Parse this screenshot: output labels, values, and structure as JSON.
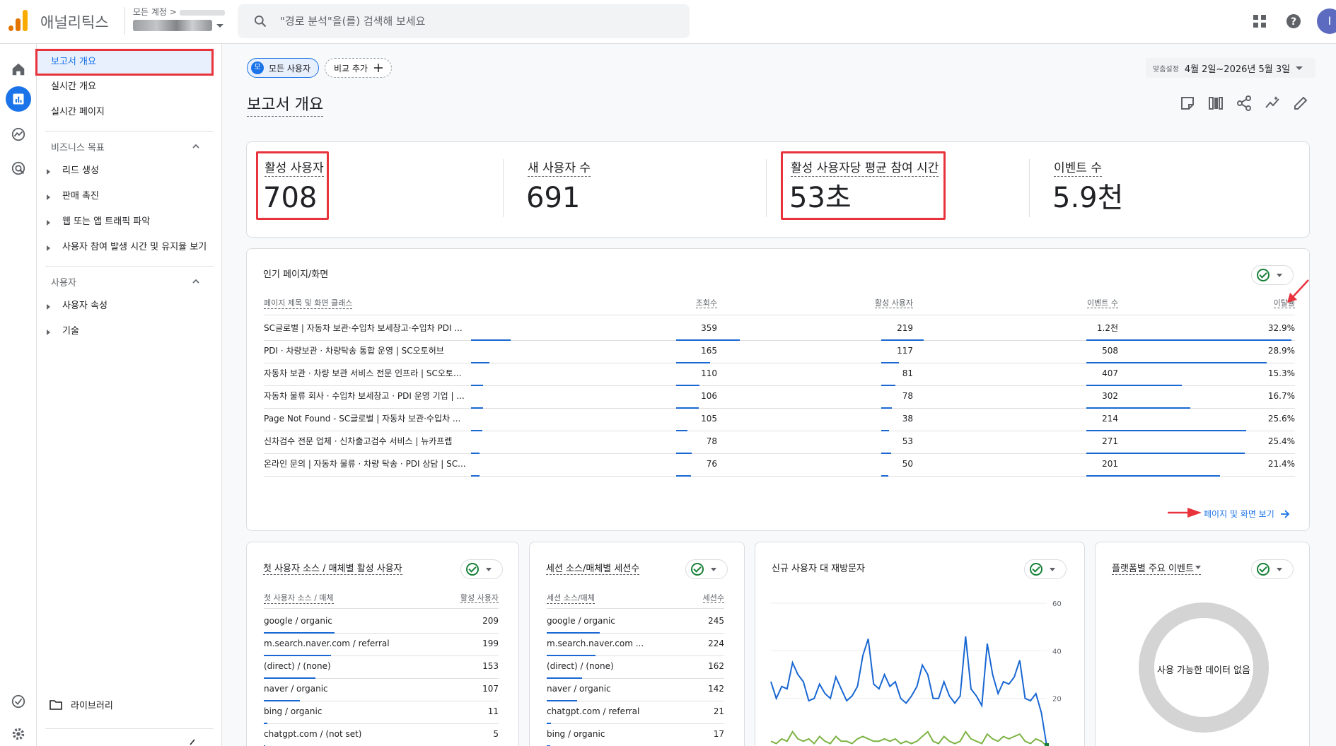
{
  "header": {
    "app_title": "애널리틱스",
    "account_path": "모든 계정 >",
    "search_placeholder": "\"경로 분석\"을(를) 검색해 보세요",
    "avatar_initial": "I"
  },
  "sidenav": {
    "top_items": [
      "보고서 개요",
      "실시간 개요",
      "실시간 페이지"
    ],
    "section1": {
      "label": "비즈니스 목표",
      "items": [
        "리드 생성",
        "판매 촉진",
        "웹 또는 앱 트래픽 파악",
        "사용자 참여 발생 시간 및 유지율 보기"
      ]
    },
    "section2": {
      "label": "사용자",
      "items": [
        "사용자 속성",
        "기술"
      ]
    },
    "library": "라이브러리"
  },
  "toolbar": {
    "segment_badge": "모",
    "segment": "모든 사용자",
    "add_compare": "비교 추가",
    "date_label": "맞춤설정",
    "date_range": "4월 2일~2026년 5월 3일"
  },
  "page_title": "보고서 개요",
  "kpis": [
    {
      "label": "활성 사용자",
      "value": "708"
    },
    {
      "label": "새 사용자 수",
      "value": "691"
    },
    {
      "label": "활성 사용자당 평균 참여 시간",
      "value": "53초"
    },
    {
      "label": "이벤트 수",
      "value": "5.9천"
    }
  ],
  "top_pages": {
    "title": "인기 페이지/화면",
    "headers": [
      "페이지 제목 및 화면 클래스",
      "조회수",
      "활성 사용자",
      "이벤트 수",
      "이탈률"
    ],
    "rows": [
      {
        "title": "SC글로벌 | 자동차 보관·수입차 보세창고·수입차 PDI ...",
        "views": "359",
        "users": "219",
        "events": "1.2천",
        "bounce": "32.9%",
        "v": 359,
        "u": 219,
        "e": 1200,
        "b": 32.9
      },
      {
        "title": "PDI · 차량보관 · 차량탁송 통합 운영 | SC오토허브",
        "views": "165",
        "users": "117",
        "events": "508",
        "bounce": "28.9%",
        "v": 165,
        "u": 117,
        "e": 508,
        "b": 28.9
      },
      {
        "title": "자동차 보관 · 차량 보관 서비스 전문 인프라 | SC오토...",
        "views": "110",
        "users": "81",
        "events": "407",
        "bounce": "15.3%",
        "v": 110,
        "u": 81,
        "e": 407,
        "b": 15.3
      },
      {
        "title": "자동차 물류 회사 · 수입차 보세창고 · PDI 운영 기업 | ...",
        "views": "106",
        "users": "78",
        "events": "302",
        "bounce": "16.7%",
        "v": 106,
        "u": 78,
        "e": 302,
        "b": 16.7
      },
      {
        "title": "Page Not Found - SC글로벌 | 자동차 보관·수입차 ...",
        "views": "105",
        "users": "38",
        "events": "214",
        "bounce": "25.6%",
        "v": 105,
        "u": 38,
        "e": 214,
        "b": 25.6
      },
      {
        "title": "신차검수 전문 업체 · 신차출고검수 서비스 | 뉴카프렙",
        "views": "78",
        "users": "53",
        "events": "271",
        "bounce": "25.4%",
        "v": 78,
        "u": 53,
        "e": 271,
        "b": 25.4
      },
      {
        "title": "온라인 문의 | 자동차 물류 · 차량 탁송 · PDI 상담 | SC...",
        "views": "76",
        "users": "50",
        "events": "201",
        "bounce": "21.4%",
        "v": 76,
        "u": 50,
        "e": 201,
        "b": 21.4
      }
    ],
    "link": "페이지 및 화면 보기"
  },
  "first_source": {
    "title": "첫 사용자 소스 / 매체별 활성 사용자",
    "headers": [
      "첫 사용자 소스 / 매체",
      "활성 사용자"
    ],
    "rows": [
      {
        "label": "google / organic",
        "value": "209",
        "n": 209
      },
      {
        "label": "m.search.naver.com / referral",
        "value": "199",
        "n": 199
      },
      {
        "label": "(direct) / (none)",
        "value": "153",
        "n": 153
      },
      {
        "label": "naver / organic",
        "value": "107",
        "n": 107
      },
      {
        "label": "bing / organic",
        "value": "11",
        "n": 11
      },
      {
        "label": "chatgpt.com / (not set)",
        "value": "5",
        "n": 5
      }
    ]
  },
  "session_source": {
    "title": "세션 소스/매체별 세션수",
    "headers": [
      "세션 소스/매체",
      "세션수"
    ],
    "rows": [
      {
        "label": "google / organic",
        "value": "245",
        "n": 245
      },
      {
        "label": "m.search.naver.com ...",
        "value": "224",
        "n": 224
      },
      {
        "label": "(direct) / (none)",
        "value": "162",
        "n": 162
      },
      {
        "label": "naver / organic",
        "value": "142",
        "n": 142
      },
      {
        "label": "chatgpt.com / referral",
        "value": "21",
        "n": 21
      },
      {
        "label": "bing / organic",
        "value": "17",
        "n": 17
      }
    ]
  },
  "new_vs_returning": {
    "title": "신규 사용자 대 재방문자",
    "chart_data": {
      "type": "line",
      "ylim": [
        0,
        60
      ],
      "yticks": [
        "60",
        "40",
        "20"
      ],
      "series": [
        {
          "color": "#1967d2",
          "values": [
            27,
            20,
            25,
            24,
            35,
            30,
            27,
            19,
            20,
            26,
            22,
            20,
            29,
            24,
            19,
            21,
            25,
            38,
            45,
            26,
            24,
            30,
            25,
            27,
            20,
            18,
            21,
            25,
            34,
            30,
            20,
            20,
            27,
            21,
            18,
            21,
            46,
            24,
            21,
            17,
            43,
            30,
            22,
            27,
            26,
            29,
            36,
            20,
            19,
            22,
            14,
            0
          ]
        },
        {
          "color": "#7cb342",
          "values": [
            2,
            1,
            3,
            2,
            6,
            3,
            2,
            3,
            1,
            4,
            2,
            1,
            4,
            2,
            2,
            1,
            3,
            4,
            3,
            2,
            2,
            3,
            2,
            3,
            1,
            2,
            1,
            2,
            4,
            6,
            2,
            1,
            4,
            2,
            1,
            2,
            6,
            3,
            2,
            1,
            5,
            3,
            2,
            4,
            3,
            4,
            5,
            2,
            1,
            3,
            2,
            0
          ]
        }
      ]
    }
  },
  "platform_events": {
    "title": "플랫폼별 주요 이벤트",
    "empty": "사용 가능한 데이터 없음"
  }
}
